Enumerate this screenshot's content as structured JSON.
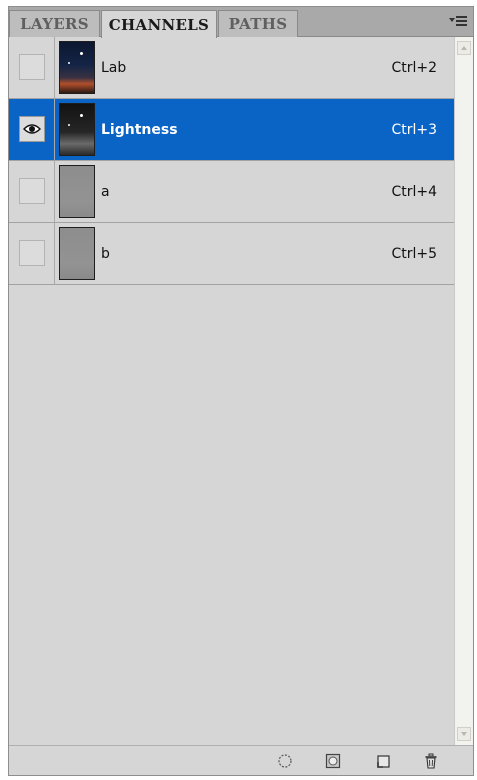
{
  "tabs": [
    {
      "label": "LAYERS",
      "active": false
    },
    {
      "label": "CHANNELS",
      "active": true
    },
    {
      "label": "PATHS",
      "active": false
    }
  ],
  "channels": [
    {
      "name": "Lab",
      "shortcut": "Ctrl+2",
      "visible": false,
      "selected": false,
      "thumbnail": "color"
    },
    {
      "name": "Lightness",
      "shortcut": "Ctrl+3",
      "visible": true,
      "selected": true,
      "thumbnail": "gray"
    },
    {
      "name": "a",
      "shortcut": "Ctrl+4",
      "visible": false,
      "selected": false,
      "thumbnail": "flat"
    },
    {
      "name": "b",
      "shortcut": "Ctrl+5",
      "visible": false,
      "selected": false,
      "thumbnail": "flat"
    }
  ],
  "bottom_actions": [
    {
      "icon": "load-channel-as-selection-icon"
    },
    {
      "icon": "save-selection-as-channel-icon"
    },
    {
      "icon": "create-new-channel-icon"
    },
    {
      "icon": "delete-channel-icon"
    }
  ],
  "colors": {
    "selection": "#0a64c6",
    "panel_bg": "#d6d6d6",
    "tabbar_bg": "#a9a9a9"
  }
}
